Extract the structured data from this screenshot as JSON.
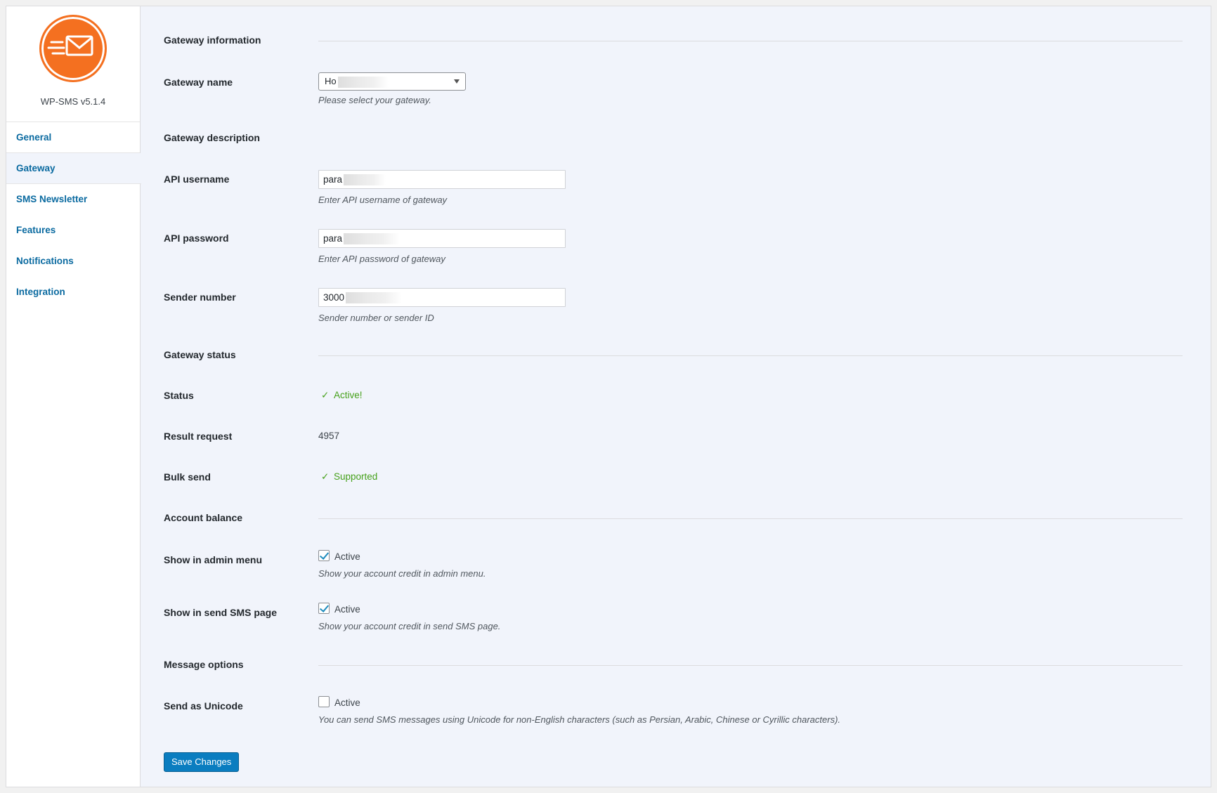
{
  "sidebar": {
    "version": "WP-SMS v5.1.4",
    "items": [
      {
        "label": "General"
      },
      {
        "label": "Gateway"
      },
      {
        "label": "SMS Newsletter"
      },
      {
        "label": "Features"
      },
      {
        "label": "Notifications"
      },
      {
        "label": "Integration"
      }
    ],
    "active": "Gateway"
  },
  "sections": {
    "gateway_information": "Gateway information",
    "gateway_description": "Gateway description",
    "gateway_status": "Gateway status",
    "account_balance": "Account balance",
    "message_options": "Message options"
  },
  "fields": {
    "gateway_name": {
      "label": "Gateway name",
      "value": "Ho",
      "desc": "Please select your gateway."
    },
    "api_username": {
      "label": "API username",
      "value": "para",
      "desc": "Enter API username of gateway"
    },
    "api_password": {
      "label": "API password",
      "value": "para",
      "desc": "Enter API password of gateway"
    },
    "sender_number": {
      "label": "Sender number",
      "value": "3000",
      "desc": "Sender number or sender ID"
    },
    "status": {
      "label": "Status",
      "value": "Active!"
    },
    "result_request": {
      "label": "Result request",
      "value": "4957"
    },
    "bulk_send": {
      "label": "Bulk send",
      "value": "Supported"
    },
    "show_admin_menu": {
      "label": "Show in admin menu",
      "option": "Active",
      "checked": true,
      "desc": "Show your account credit in admin menu."
    },
    "show_send_page": {
      "label": "Show in send SMS page",
      "option": "Active",
      "checked": true,
      "desc": "Show your account credit in send SMS page."
    },
    "send_unicode": {
      "label": "Send as Unicode",
      "option": "Active",
      "checked": false,
      "desc": "You can send SMS messages using Unicode for non-English characters (such as Persian, Arabic, Chinese or Cyrillic characters)."
    }
  },
  "save_label": "Save Changes",
  "colors": {
    "brand": "#f47020",
    "link": "#0a6aa0",
    "ok": "#46a11b",
    "primary": "#0a7dc0"
  },
  "icons": {
    "logo": "envelope-fast-icon",
    "check": "checkmark-icon",
    "dropdown": "triangle-down-icon"
  }
}
